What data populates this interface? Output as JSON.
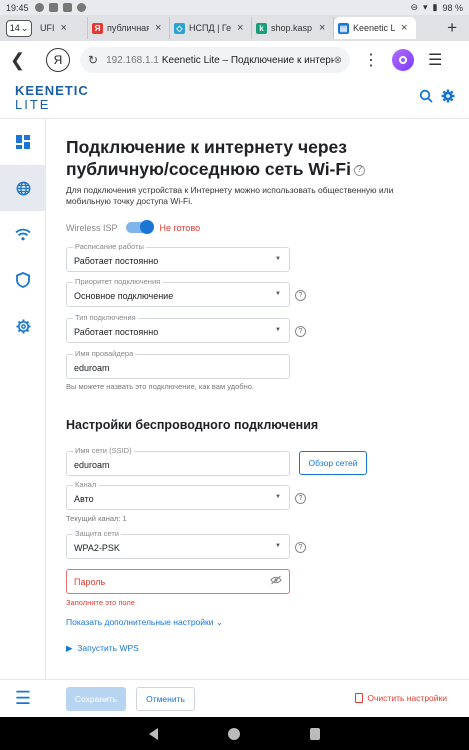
{
  "status_bar": {
    "time": "19:45",
    "battery": "98 %"
  },
  "tabs": {
    "count": "14",
    "items": [
      {
        "title": "UFI",
        "favicon": "ufi-icon",
        "active": false
      },
      {
        "title": "публичная",
        "favicon": "yandex-icon",
        "active": false
      },
      {
        "title": "НСПД | Ге",
        "favicon": "nspd-icon",
        "active": false
      },
      {
        "title": "shop.kasp",
        "favicon": "kaspi-icon",
        "active": false
      },
      {
        "title": "Keenetic L",
        "favicon": "keenetic-icon",
        "active": true
      }
    ]
  },
  "address_bar": {
    "host": "192.168.1.1",
    "title": "Keenetic Lite – Подключение к интерне"
  },
  "app": {
    "logo_line1": "KEENETIC",
    "logo_line2": "LITE"
  },
  "sidebar": {
    "items": [
      {
        "name": "dashboard-icon",
        "active": false
      },
      {
        "name": "globe-icon",
        "active": true
      },
      {
        "name": "wifi-icon",
        "active": false
      },
      {
        "name": "shield-icon",
        "active": false
      },
      {
        "name": "gear-icon",
        "active": false
      }
    ]
  },
  "page": {
    "title": "Подключение к интернету через публичную/соседнюю сеть Wi-Fi",
    "help_glyph": "?",
    "intro": "Для подключения устройства к Интернету можно использовать общественную или мобильную точку доступа Wi-Fi.",
    "wisp_label": "Wireless ISP",
    "wisp_enabled": true,
    "wisp_status": "Не готово",
    "schedule": {
      "label": "Расписание работы",
      "value": "Работает постоянно"
    },
    "priority": {
      "label": "Приоритет подключения",
      "value": "Основное подключение"
    },
    "conn_type": {
      "label": "Тип подключения",
      "value": "Работает постоянно"
    },
    "provider": {
      "label": "Имя провайдера",
      "value": "eduroam"
    },
    "provider_hint": "Вы можете назвать это подключение, как вам удобно.",
    "wireless_title": "Настройки беспроводного подключения",
    "ssid": {
      "label": "Имя сети (SSID)",
      "value": "eduroam"
    },
    "scan_button": "Обзор сетей",
    "channel": {
      "label": "Канал",
      "value": "Авто"
    },
    "current_channel": "Текущий канал: 1",
    "security": {
      "label": "Защита сети",
      "value": "WPA2-PSK"
    },
    "password_placeholder": "Пароль",
    "password_error": "Заполните это поле",
    "advanced_link": "Показать дополнительные настройки",
    "wps_link": "Запустить WPS"
  },
  "actions": {
    "save": "Сохранить",
    "cancel": "Отменить",
    "reset": "Очистить настройки"
  },
  "colors": {
    "accent": "#1976d2",
    "error": "#e03c31"
  }
}
